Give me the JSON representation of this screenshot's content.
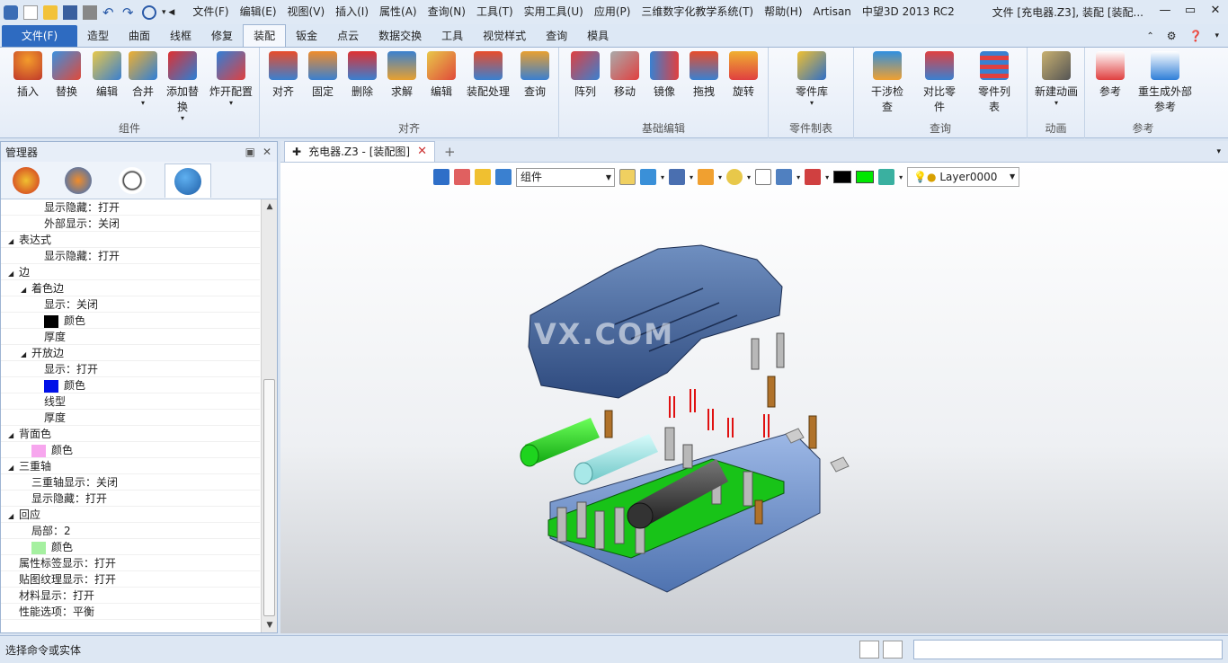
{
  "titlebar": {
    "menus": [
      "文件(F)",
      "编辑(E)",
      "视图(V)",
      "插入(I)",
      "属性(A)",
      "查询(N)",
      "工具(T)",
      "实用工具(U)",
      "应用(P)",
      "三维数字化教学系统(T)",
      "帮助(H)",
      "Artisan"
    ],
    "app_name": "中望3D 2013 RC2",
    "doc_title": "文件 [充电器.Z3], 装配 [装配..."
  },
  "ribbon_tabs": [
    "文件(F)",
    "造型",
    "曲面",
    "线框",
    "修复",
    "装配",
    "钣金",
    "点云",
    "数据交换",
    "工具",
    "视觉样式",
    "查询",
    "模具"
  ],
  "active_tab": "装配",
  "ribbon_groups": [
    {
      "label": "组件",
      "buttons": [
        {
          "label": "插入"
        },
        {
          "label": "替换"
        },
        {
          "label": "编辑"
        },
        {
          "label": "合并"
        },
        {
          "label": "添加替换"
        },
        {
          "label": "炸开配置"
        }
      ]
    },
    {
      "label": "对齐",
      "buttons": [
        {
          "label": "对齐"
        },
        {
          "label": "固定"
        },
        {
          "label": "删除"
        },
        {
          "label": "求解"
        },
        {
          "label": "编辑"
        },
        {
          "label": "装配处理"
        },
        {
          "label": "查询"
        }
      ]
    },
    {
      "label": "基础编辑",
      "buttons": [
        {
          "label": "阵列"
        },
        {
          "label": "移动"
        },
        {
          "label": "镜像"
        },
        {
          "label": "拖拽"
        },
        {
          "label": "旋转"
        }
      ]
    },
    {
      "label": "零件制表",
      "buttons": [
        {
          "label": "零件库"
        }
      ]
    },
    {
      "label": "查询",
      "buttons": [
        {
          "label": "干涉检查"
        },
        {
          "label": "对比零件"
        },
        {
          "label": "零件列表"
        }
      ]
    },
    {
      "label": "动画",
      "buttons": [
        {
          "label": "新建动画"
        }
      ]
    },
    {
      "label": "参考",
      "buttons": [
        {
          "label": "参考"
        },
        {
          "label": "重生成外部参考"
        }
      ]
    }
  ],
  "manager": {
    "title": "管理器",
    "tree": [
      {
        "level": 2,
        "text": "显示隐藏：打开"
      },
      {
        "level": 2,
        "text": "外部显示：关闭"
      },
      {
        "level": 0,
        "text": "表达式",
        "toggle": "◢"
      },
      {
        "level": 2,
        "text": "显示隐藏：打开"
      },
      {
        "level": 0,
        "text": "边",
        "toggle": "◢"
      },
      {
        "level": 1,
        "text": "着色边",
        "toggle": "◢"
      },
      {
        "level": 2,
        "text": "显示：关闭"
      },
      {
        "level": 2,
        "text": "颜色",
        "swatch": "#000000"
      },
      {
        "level": 2,
        "text": "厚度"
      },
      {
        "level": 1,
        "text": "开放边",
        "toggle": "◢"
      },
      {
        "level": 2,
        "text": "显示：打开"
      },
      {
        "level": 2,
        "text": "颜色",
        "swatch": "#0010e8"
      },
      {
        "level": 2,
        "text": "线型"
      },
      {
        "level": 2,
        "text": "厚度"
      },
      {
        "level": 0,
        "text": "背面色",
        "toggle": "◢"
      },
      {
        "level": 1,
        "text": "颜色",
        "swatch": "#f7a6ee"
      },
      {
        "level": 0,
        "text": "三重轴",
        "toggle": "◢"
      },
      {
        "level": 1,
        "text": "三重轴显示：关闭"
      },
      {
        "level": 1,
        "text": "显示隐藏：打开"
      },
      {
        "level": 0,
        "text": "回应",
        "toggle": "◢"
      },
      {
        "level": 1,
        "text": "局部：2"
      },
      {
        "level": 1,
        "text": "颜色",
        "swatch": "#a5f0a0"
      },
      {
        "level": 0,
        "text": "属性标签显示：打开"
      },
      {
        "level": 0,
        "text": "贴图纹理显示：打开"
      },
      {
        "level": 0,
        "text": "材料显示：打开"
      },
      {
        "level": 0,
        "text": "性能选项：平衡"
      }
    ]
  },
  "document": {
    "tab_label": "充电器.Z3 - [装配图]",
    "filter_value": "组件",
    "layer_value": "Layer0000",
    "watermark": "VX.COM"
  },
  "status": {
    "text": "选择命令或实体"
  }
}
